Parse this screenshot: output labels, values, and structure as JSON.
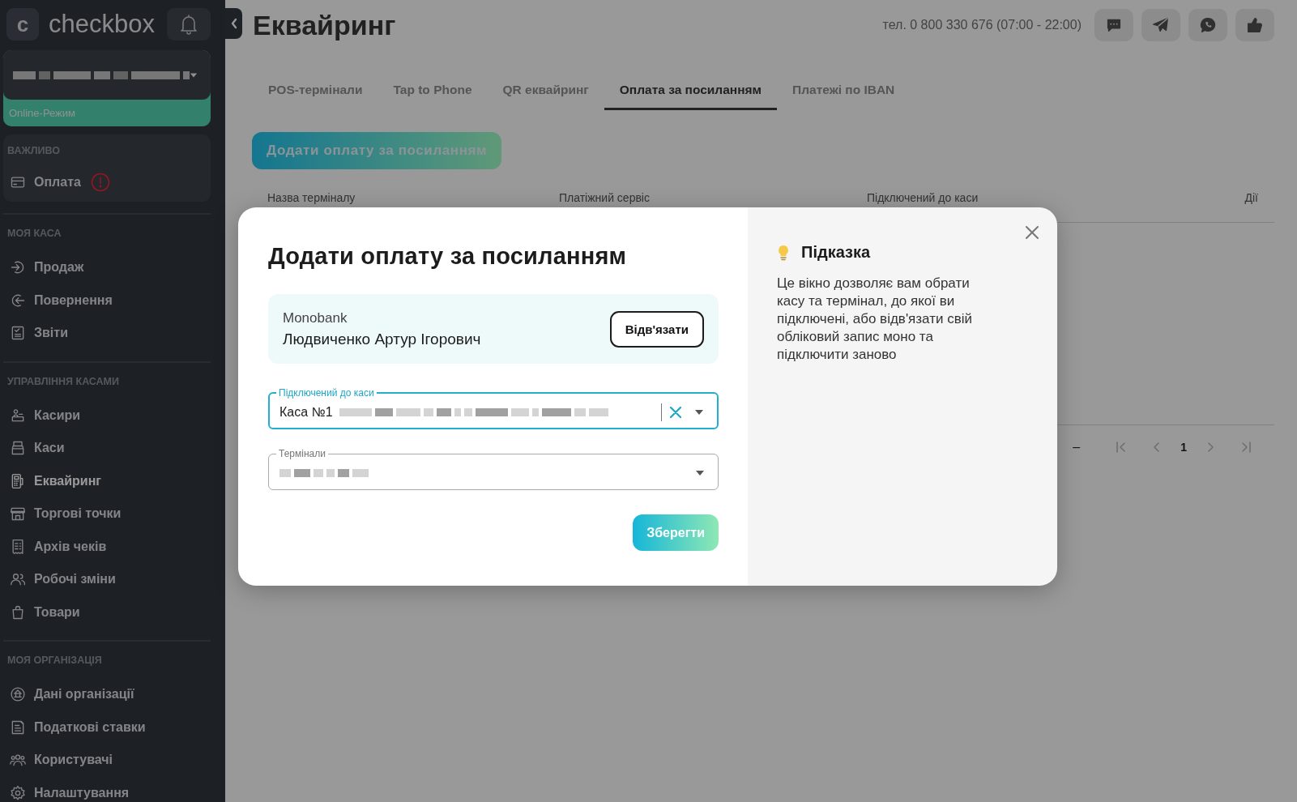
{
  "sidebar": {
    "logo": {
      "letter": "c",
      "text": "checkbox"
    },
    "store_select": {
      "status": "Online-Режим"
    },
    "sections": [
      {
        "kind": "card",
        "title": "ВАЖЛИВО",
        "items": [
          {
            "label": "Оплата",
            "alert": true,
            "selected": false
          }
        ]
      },
      {
        "kind": "list",
        "title": "МОЯ КАСА",
        "items": [
          {
            "label": "Продаж",
            "selected": false
          },
          {
            "label": "Повернення",
            "selected": false
          },
          {
            "label": "Звіти",
            "selected": false
          }
        ]
      },
      {
        "kind": "list",
        "title": "УПРАВЛІННЯ КАСАМИ",
        "items": [
          {
            "label": "Касири",
            "selected": false
          },
          {
            "label": "Каси",
            "selected": false
          },
          {
            "label": "Еквайринг",
            "selected": true
          },
          {
            "label": "Торгові точки",
            "selected": false
          },
          {
            "label": "Архів чеків",
            "selected": false
          },
          {
            "label": "Робочі зміни",
            "selected": false
          },
          {
            "label": "Товари",
            "selected": false
          }
        ]
      },
      {
        "kind": "list",
        "title": "МОЯ ОРГАНІЗАЦІЯ",
        "items": [
          {
            "label": "Дані організації",
            "selected": false
          },
          {
            "label": "Податкові ставки",
            "selected": false
          },
          {
            "label": "Користувачі",
            "selected": false
          },
          {
            "label": "Налаштування",
            "selected": false
          }
        ]
      }
    ]
  },
  "header": {
    "title": "Еквайринг",
    "phone": "тел. 0 800 330 676 (07:00 - 22:00)"
  },
  "tabs": [
    {
      "label": "POS-термінали",
      "selected": false
    },
    {
      "label": "Tap to Phone",
      "selected": false
    },
    {
      "label": "QR еквайринг",
      "selected": false
    },
    {
      "label": "Оплата за посиланням",
      "selected": true
    },
    {
      "label": "Платежі по IBAN",
      "selected": false
    }
  ],
  "add_button": "Додати оплату за посиланням",
  "table": {
    "columns": [
      "Назва терміналу",
      "Платіжний сервіс",
      "Підключений до каси",
      "Дії"
    ]
  },
  "pagination": {
    "range": "–",
    "page": "1"
  },
  "modal": {
    "title": "Додати оплату за посиланням",
    "account": {
      "bank": "Monobank",
      "name": "Людвиченко Артур Ігорович",
      "action": "Відв'язати"
    },
    "fields": [
      {
        "label": "Підключений до каси",
        "value": "Каса №1",
        "focused": true,
        "clearable": true
      },
      {
        "label": "Термінали",
        "focused": false,
        "clearable": false
      }
    ],
    "save": "Зберегти",
    "hint": {
      "title": "Підказка",
      "text": "Це вікно дозволяє вам обрати касу та термінал, до якої ви підключені, або відв'язати свій обліковий запис моно та підключити заново"
    }
  }
}
